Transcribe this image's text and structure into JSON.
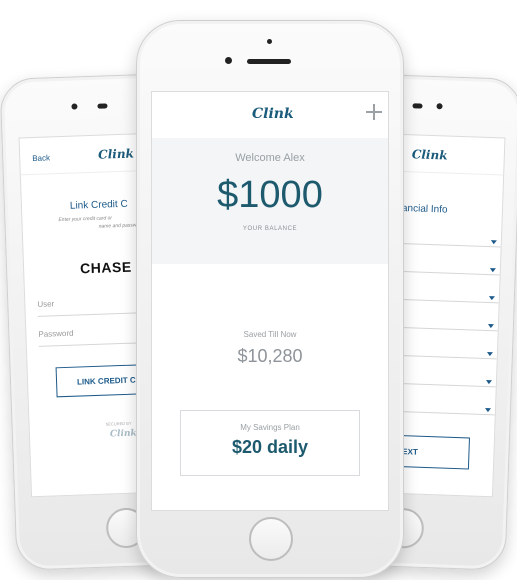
{
  "left_screen": {
    "back_label": "Back",
    "logo": "Clink",
    "title": "Link Credit C",
    "subtitle_line1": "Enter your credit card or",
    "subtitle_line2": "name and passw",
    "bank_name": "CHASE",
    "user_placeholder": "User",
    "password_placeholder": "Password",
    "link_button": "LINK CREDIT C",
    "secured_by": "SECURED BY",
    "footer_logo": "Clink"
  },
  "center_screen": {
    "logo": "Clink",
    "welcome": "Welcome Alex",
    "balance": "$1000",
    "balance_caption": "YOUR BALANCE",
    "saved_label": "Saved Till Now",
    "saved_value": "$10,280",
    "plan_label": "My Savings Plan",
    "plan_value": "$20 daily"
  },
  "right_screen": {
    "logo": "Clink",
    "title": "ancial Info",
    "next_button": "NEXT",
    "dropdown_count": 7
  },
  "colors": {
    "brand": "#1a5a7a",
    "balance": "#1d5a6e",
    "header_bg": "#f3f5f7"
  },
  "icons": {
    "add": "plus-icon",
    "dropdown": "chevron-down-icon"
  }
}
